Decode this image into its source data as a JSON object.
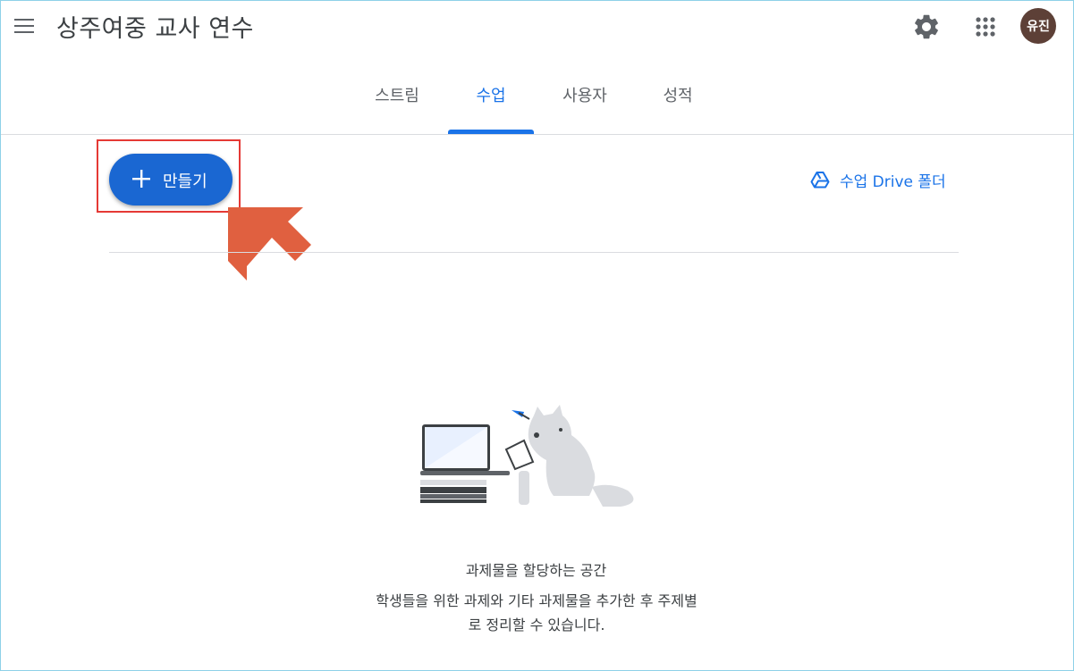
{
  "header": {
    "class_title": "상주여중 교사 연수",
    "avatar_text": "유진",
    "icons": [
      "menu-icon",
      "gear-icon",
      "apps-grid-icon"
    ]
  },
  "tabs": [
    {
      "label": "스트림",
      "active": false
    },
    {
      "label": "수업",
      "active": true
    },
    {
      "label": "사용자",
      "active": false
    },
    {
      "label": "성적",
      "active": false
    }
  ],
  "toolbar": {
    "create_label": "만들기",
    "drive_label": "수업 Drive 폴더"
  },
  "empty_state": {
    "title": "과제물을 할당하는 공간",
    "description_line1": "학생들을 위한 과제와 기타 과제물을 추가한 후 주제별",
    "description_line2": "로 정리할 수 있습니다."
  },
  "colors": {
    "accent": "#1a73e8",
    "create_button": "#1a67d2",
    "avatar_bg": "#5d4037",
    "highlight": "#e53935",
    "arrow": "#e06040"
  }
}
